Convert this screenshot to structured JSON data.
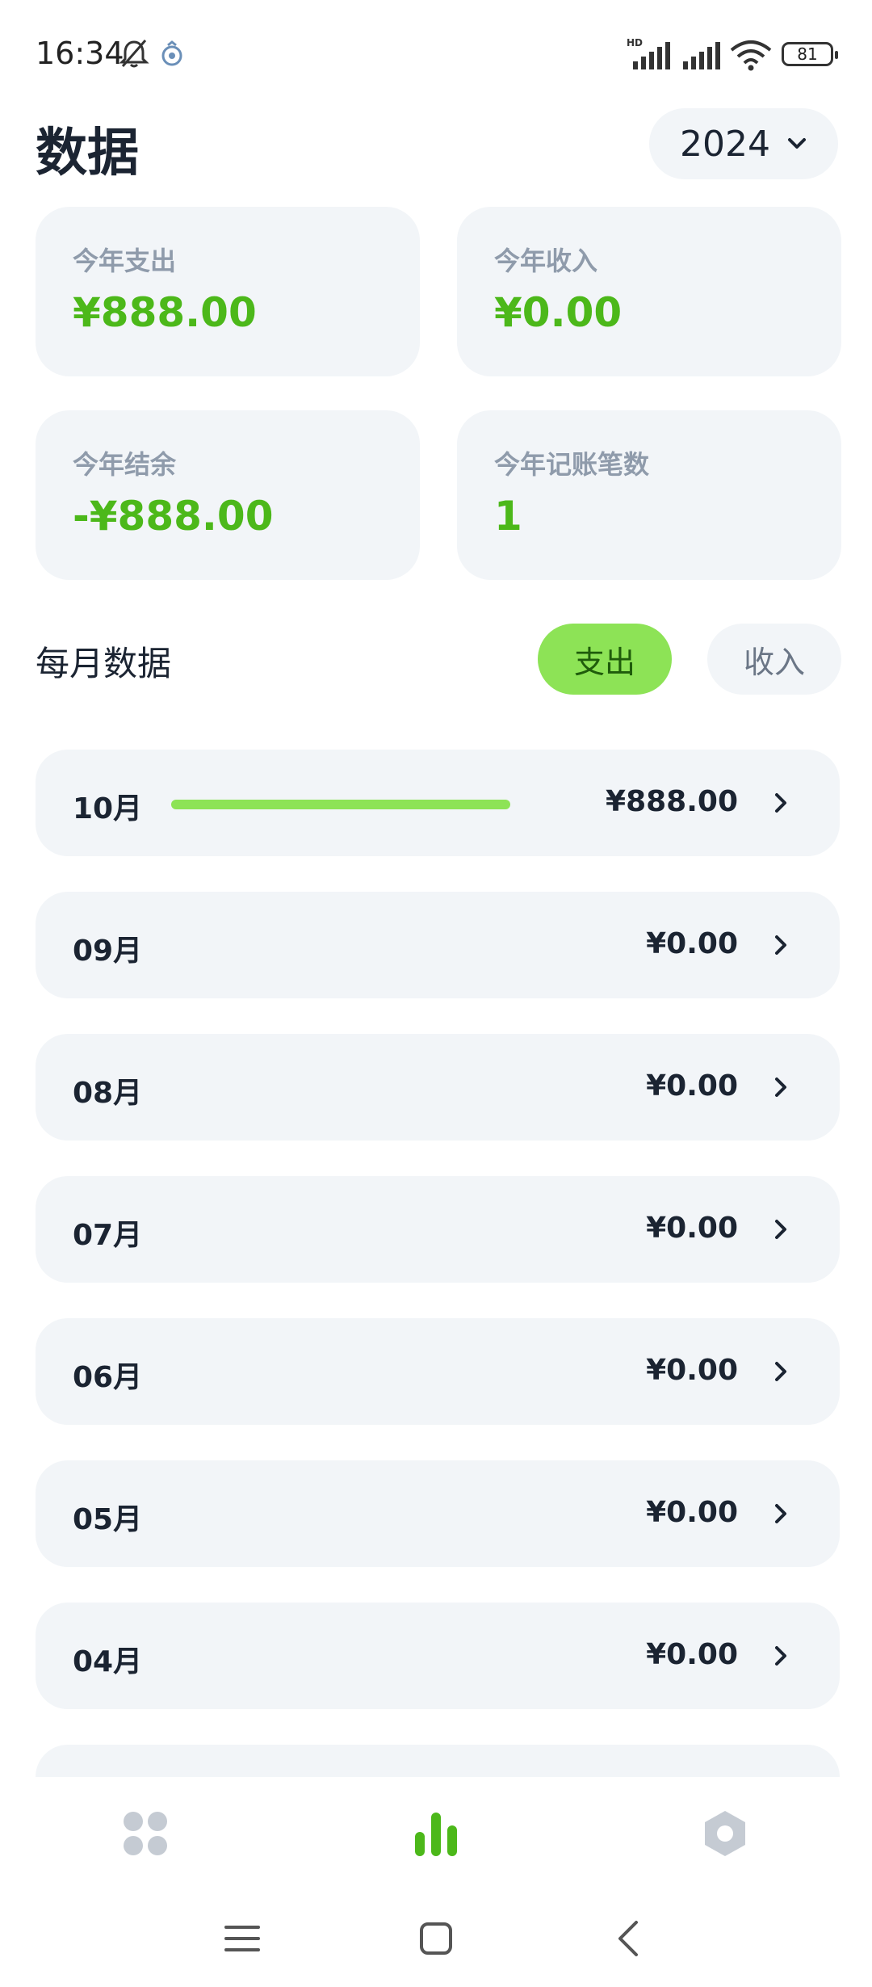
{
  "status_bar": {
    "time": "16:34",
    "battery": "81",
    "icons": [
      "bell-off-icon",
      "app-notification-icon",
      "hd-signal-icon",
      "signal-icon",
      "wifi-icon",
      "battery-icon"
    ]
  },
  "header": {
    "title": "数据",
    "year": "2024",
    "year_icon": "chevron-down-icon"
  },
  "summary": {
    "expense": {
      "label": "今年支出",
      "value": "¥888.00"
    },
    "income": {
      "label": "今年收入",
      "value": "¥0.00"
    },
    "balance": {
      "label": "今年结余",
      "value": "-¥888.00"
    },
    "count": {
      "label": "今年记账笔数",
      "value": "1"
    }
  },
  "monthly": {
    "title": "每月数据",
    "tabs": {
      "expense": "支出",
      "income": "收入"
    },
    "selected_tab": "支出",
    "months": [
      {
        "label": "10月",
        "amount": "¥888.00",
        "share": 1.0
      },
      {
        "label": "09月",
        "amount": "¥0.00",
        "share": 0
      },
      {
        "label": "08月",
        "amount": "¥0.00",
        "share": 0
      },
      {
        "label": "07月",
        "amount": "¥0.00",
        "share": 0
      },
      {
        "label": "06月",
        "amount": "¥0.00",
        "share": 0
      },
      {
        "label": "05月",
        "amount": "¥0.00",
        "share": 0
      },
      {
        "label": "04月",
        "amount": "¥0.00",
        "share": 0
      }
    ]
  },
  "tab_bar": {
    "items": [
      {
        "icon": "grid-icon",
        "active": false
      },
      {
        "icon": "bar-chart-icon",
        "active": true
      },
      {
        "icon": "settings-hexagon-icon",
        "active": false
      }
    ]
  },
  "colors": {
    "accent": "#8de356",
    "accent_text": "#4cb81a",
    "card_bg": "#f2f5f8",
    "muted_icon": "#c5cbd3"
  }
}
